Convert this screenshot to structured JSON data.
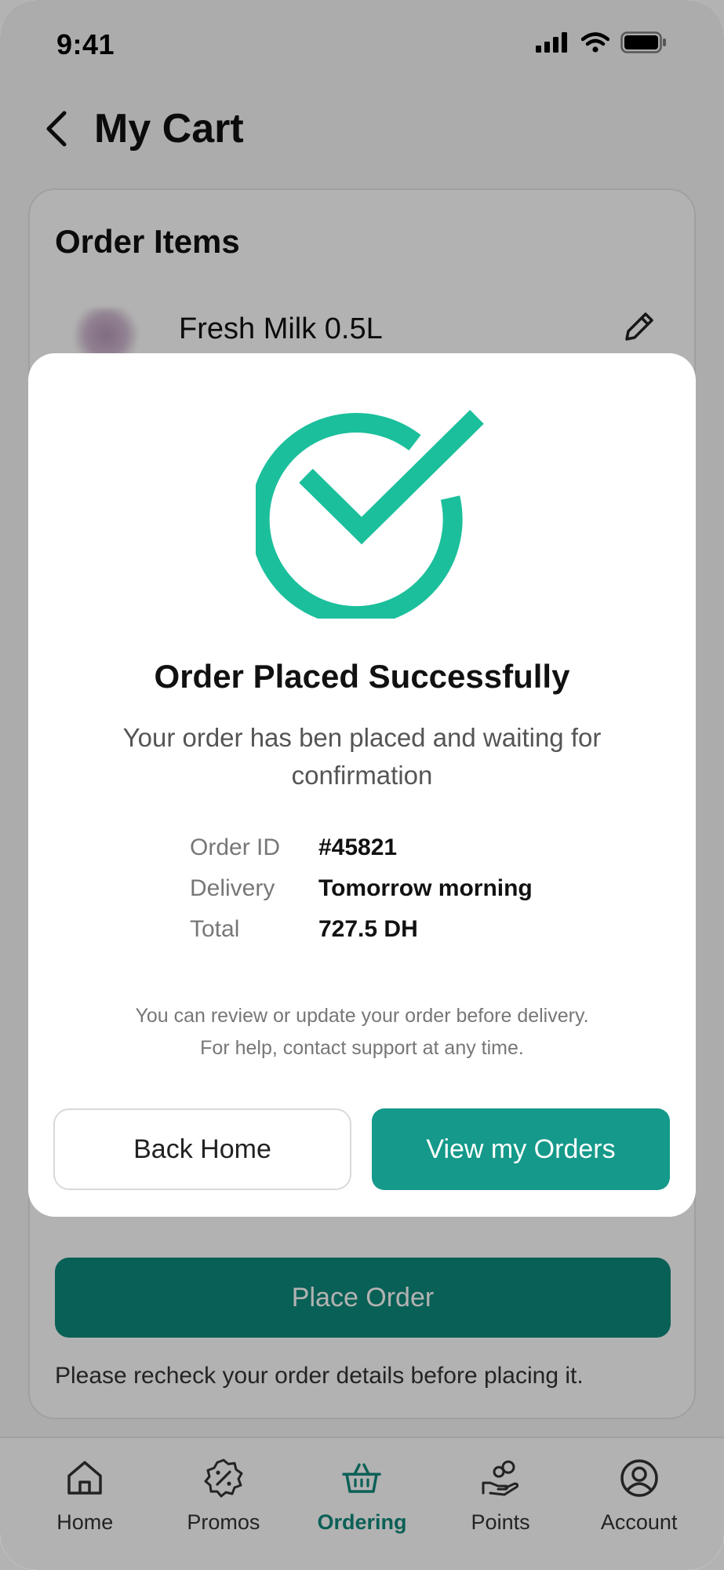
{
  "status_bar": {
    "time": "9:41"
  },
  "header": {
    "title": "My Cart"
  },
  "cart": {
    "section_title": "Order Items",
    "items": [
      {
        "name": "Fresh Milk 0.5L"
      }
    ],
    "place_order_label": "Place Order",
    "hint": "Please recheck your order details before placing it."
  },
  "modal": {
    "title": "Order Placed Successfully",
    "message": "Your order has ben placed and waiting for confirmation",
    "details": [
      {
        "label": "Order ID",
        "value": "#45821"
      },
      {
        "label": "Delivery",
        "value": "Tomorrow morning"
      },
      {
        "label": "Total",
        "value": "727.5 DH"
      }
    ],
    "note_line1": "You can review or update your order before delivery.",
    "note_line2": "For help, contact support at any time.",
    "back_home_label": "Back Home",
    "view_orders_label": "View my Orders"
  },
  "nav": {
    "items": [
      {
        "label": "Home",
        "icon": "home-icon"
      },
      {
        "label": "Promos",
        "icon": "discount-badge-icon"
      },
      {
        "label": "Ordering",
        "icon": "basket-icon",
        "active": true
      },
      {
        "label": "Points",
        "icon": "hand-coins-icon"
      },
      {
        "label": "Account",
        "icon": "user-circle-icon"
      }
    ]
  },
  "colors": {
    "accent": "#14998a",
    "dim_overlay": "rgba(0,0,0,0.3)",
    "success": "#1bbf9c"
  }
}
